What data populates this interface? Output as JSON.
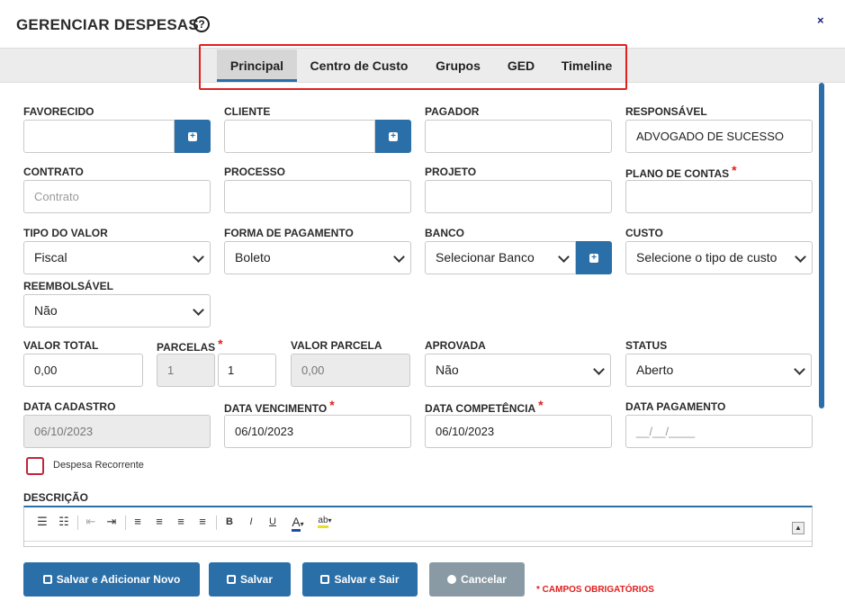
{
  "header": {
    "title": "GERENCIAR DESPESAS",
    "help": "?",
    "close": "×"
  },
  "tabs": [
    "Principal",
    "Centro de Custo",
    "Grupos",
    "GED",
    "Timeline"
  ],
  "fields": {
    "favorecido": {
      "label": "FAVORECIDO",
      "value": ""
    },
    "cliente": {
      "label": "CLIENTE",
      "value": ""
    },
    "pagador": {
      "label": "PAGADOR",
      "value": ""
    },
    "responsavel": {
      "label": "RESPONSÁVEL",
      "value": "ADVOGADO DE SUCESSO"
    },
    "contrato": {
      "label": "CONTRATO",
      "placeholder": "Contrato"
    },
    "processo": {
      "label": "PROCESSO",
      "value": ""
    },
    "projeto": {
      "label": "PROJETO",
      "value": ""
    },
    "plano_contas": {
      "label": "PLANO DE CONTAS",
      "value": ""
    },
    "tipo_valor": {
      "label": "TIPO DO VALOR",
      "value": "Fiscal"
    },
    "forma_pagamento": {
      "label": "FORMA DE PAGAMENTO",
      "value": "Boleto"
    },
    "banco": {
      "label": "BANCO",
      "value": "Selecionar Banco"
    },
    "custo": {
      "label": "CUSTO",
      "value": "Selecione o tipo de custo"
    },
    "reembolsavel": {
      "label": "REEMBOLSÁVEL",
      "value": "Não"
    },
    "valor_total": {
      "label": "VALOR TOTAL",
      "value": "0,00"
    },
    "parcelas": {
      "label": "PARCELAS",
      "value_fixed": "1",
      "value": "1"
    },
    "valor_parcela": {
      "label": "VALOR PARCELA",
      "value": "0,00"
    },
    "aprovada": {
      "label": "APROVADA",
      "value": "Não"
    },
    "status": {
      "label": "STATUS",
      "value": "Aberto"
    },
    "data_cadastro": {
      "label": "DATA CADASTRO",
      "value": "06/10/2023"
    },
    "data_vencimento": {
      "label": "DATA VENCIMENTO",
      "value": "06/10/2023"
    },
    "data_competencia": {
      "label": "DATA COMPETÊNCIA",
      "value": "06/10/2023"
    },
    "data_pagamento": {
      "label": "DATA PAGAMENTO",
      "placeholder": "__/__/____"
    }
  },
  "required_mark": "*",
  "recorrente": {
    "label": "Despesa Recorrente",
    "checked": false
  },
  "descricao": {
    "label": "DESCRIÇÃO"
  },
  "buttons": {
    "salvar_novo": "Salvar e Adicionar Novo",
    "salvar": "Salvar",
    "salvar_sair": "Salvar e Sair",
    "cancelar": "Cancelar"
  },
  "required_note": "* CAMPOS OBRIGATÓRIOS",
  "colors": {
    "primary": "#2a6fa8",
    "required": "#e0201f",
    "cancel": "#8a9aa5"
  }
}
